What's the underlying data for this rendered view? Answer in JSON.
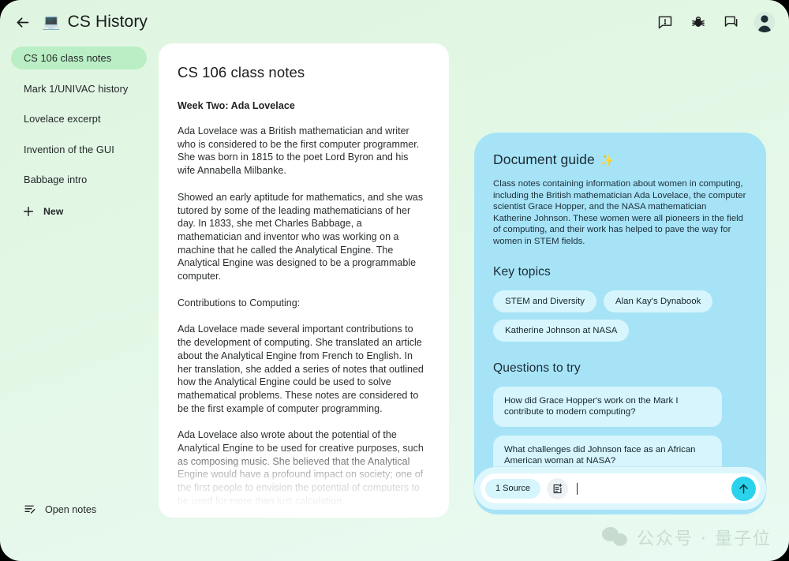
{
  "window": {
    "background_color": "#e4f7e6",
    "accent_color": "#2ad2ec",
    "panel_color": "#a6e3f7"
  },
  "topbar": {
    "back_icon": "arrow-left-icon",
    "app_emoji": "💻",
    "title": "CS History",
    "actions": [
      {
        "name": "feedback-icon",
        "label": "Feedback"
      },
      {
        "name": "bug-report-icon",
        "label": "Report a bug"
      },
      {
        "name": "chat-icon",
        "label": "Chat"
      },
      {
        "name": "avatar",
        "label": "Account"
      }
    ]
  },
  "sidebar": {
    "items": [
      {
        "label": "CS 106 class notes",
        "active": true
      },
      {
        "label": "Mark 1/UNIVAC history",
        "active": false
      },
      {
        "label": "Lovelace excerpt",
        "active": false
      },
      {
        "label": "Invention of the GUI",
        "active": false
      },
      {
        "label": "Babbage intro",
        "active": false
      }
    ],
    "new_label": "New",
    "open_notes_label": "Open notes"
  },
  "document": {
    "title": "CS 106 class notes",
    "heading": "Week Two: Ada Lovelace",
    "paragraphs": [
      "Ada Lovelace was a British mathematician and writer who is considered to be the first computer programmer. She was born in 1815 to the poet Lord Byron and his wife Annabella Milbanke.",
      "Showed an early aptitude for mathematics, and she was tutored by some of the leading mathematicians of her day. In 1833, she met Charles Babbage, a mathematician and inventor who was working on a machine that he called the Analytical Engine. The Analytical Engine was designed to be a programmable computer.",
      "Contributions to Computing:",
      "Ada Lovelace made several important contributions to the development of computing. She translated an article about the Analytical Engine from French to English. In her translation, she added a series of notes that outlined how the Analytical Engine could be used to solve mathematical problems. These notes are considered to be the first example of computer programming.",
      "Ada Lovelace also wrote about the potential of the Analytical Engine to be used for creative purposes, such as composing music. She believed that the Analytical Engine would have a profound impact on society; one of the first people to envision the potential of computers to be used for more than just calculation."
    ]
  },
  "guide": {
    "title": "Document guide",
    "sparkle": "✨",
    "description": "Class notes containing information about women in computing, including the British mathematician Ada Lovelace, the computer scientist Grace Hopper, and the NASA mathematician Katherine Johnson. These women were all pioneers in the field of computing, and their work has helped to pave the way for women in STEM fields.",
    "key_topics_title": "Key topics",
    "topics": [
      "STEM and Diversity",
      "Alan Kay's Dynabook",
      "Katherine Johnson at NASA"
    ],
    "questions_title": "Questions to try",
    "questions": [
      "How did Grace Hopper's work on the Mark I contribute to modern computing?",
      "What challenges did Johnson face as an African American woman at NASA?"
    ]
  },
  "composer": {
    "source_chip": "1 Source",
    "note_icon": "add-note-icon",
    "input_value": "",
    "input_placeholder": "",
    "send_icon": "arrow-up-icon"
  },
  "watermark": {
    "text": "公众号 · 量子位"
  }
}
